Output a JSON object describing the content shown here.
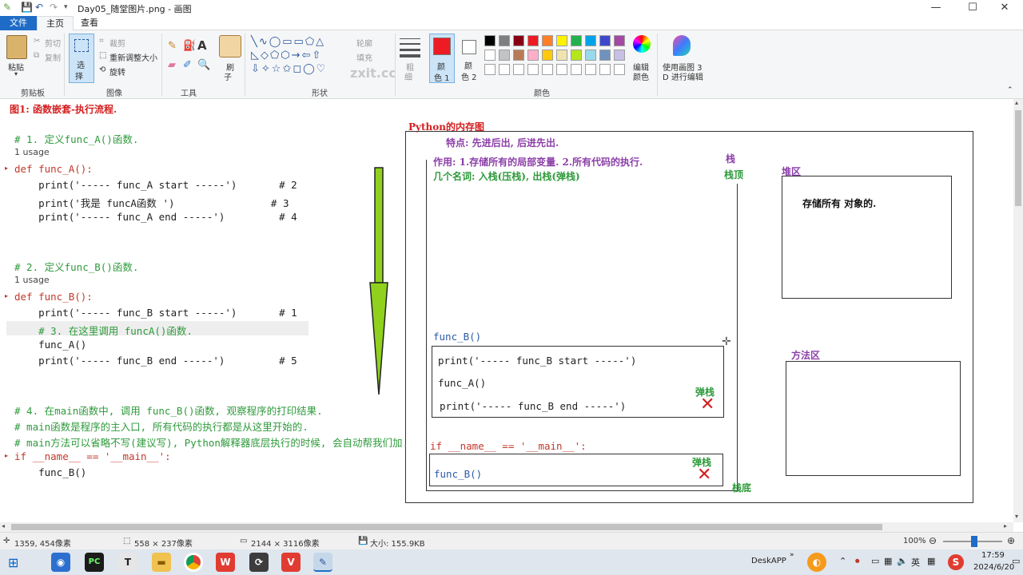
{
  "window": {
    "title": "Day05_随堂图片.png - 画图",
    "controls": {
      "minimize": "—",
      "maximize": "☐",
      "close": "✕"
    }
  },
  "tabs": [
    {
      "label": "文件"
    },
    {
      "label": "主页"
    },
    {
      "label": "查看"
    }
  ],
  "ribbon": {
    "clipboard": {
      "paste": "粘贴",
      "cut": "剪切",
      "copy": "复制",
      "group": "剪贴板"
    },
    "image": {
      "select": "选",
      "select2": "择",
      "crop": "裁剪",
      "resize": "重新调整大小",
      "rotate": "旋转",
      "group": "图像"
    },
    "tools": {
      "group": "工具"
    },
    "brushes": {
      "label": "刷",
      "label2": "子"
    },
    "shapes": {
      "outline": "轮廓",
      "fill": "填充",
      "group": "形状"
    },
    "size": {
      "label": "粗",
      "label2": "细"
    },
    "color1": {
      "label": "颜",
      "label2": "色 1"
    },
    "color2": {
      "label": "颜",
      "label2": "色 2"
    },
    "colors_group": "颜色",
    "edit_colors": {
      "label": "编辑",
      "label2": "颜色"
    },
    "paint3d": {
      "label": "使用画图 3",
      "label2": "D 进行编辑"
    },
    "watermark": "zxit.cc",
    "palette_row1": [
      "#000000",
      "#7f7f7f",
      "#880015",
      "#ed1c24",
      "#ff7f27",
      "#fff200",
      "#22b14c",
      "#00a2e8",
      "#3f48cc",
      "#a349a4"
    ],
    "palette_row2": [
      "#ffffff",
      "#c3c3c3",
      "#b97a57",
      "#ffaec9",
      "#ffc90e",
      "#efe4b0",
      "#b5e61d",
      "#99d9ea",
      "#7092be",
      "#c8bfe7"
    ],
    "color1_value": "#ed1c24",
    "color2_value": "#ffffff"
  },
  "canvas": {
    "figure_title": "图1: 函数嵌套-执行流程.",
    "code_lines": [
      {
        "text": "# 1. 定义func_A()函数.",
        "cls": "cmt"
      },
      {
        "text": "1 usage",
        "cls": "gray"
      },
      {
        "text": "def func_A():",
        "cls": "kw"
      },
      {
        "text": "    print('----- func_A start -----')       # 2",
        "cls": ""
      },
      {
        "text": "    print('我是 funcA函数 ')                # 3",
        "cls": ""
      },
      {
        "text": "    print('----- func_A end -----')         # 4",
        "cls": ""
      },
      {
        "text": "# 2. 定义func_B()函数.",
        "cls": "cmt"
      },
      {
        "text": "1 usage",
        "cls": "gray"
      },
      {
        "text": "def func_B():",
        "cls": "kw"
      },
      {
        "text": "    print('----- func_B start -----')       # 1",
        "cls": ""
      },
      {
        "text": "    # 3. 在这里调用 funcA()函数.",
        "cls": "cmt"
      },
      {
        "text": "    func_A()",
        "cls": ""
      },
      {
        "text": "    print('----- func_B end -----')         # 5",
        "cls": ""
      },
      {
        "text": "# 4. 在main函数中, 调用 func_B()函数, 观察程序的打印结果.",
        "cls": "cmt"
      },
      {
        "text": "# main函数是程序的主入口, 所有代码的执行都是从这里开始的.",
        "cls": "cmt"
      },
      {
        "text": "# main方法可以省略不写(建议写), Python解释器底层执行的时候, 会自动帮我们加.",
        "cls": "cmt"
      },
      {
        "text": "if __name__ == '__main__':",
        "cls": "kw"
      },
      {
        "text": "    func_B()",
        "cls": ""
      }
    ],
    "memory": {
      "title": "Python的内存图",
      "feature": "特点: 先进后出, 后进先出.",
      "purpose": "作用: 1.存储所有的局部变量.  2.所有代码的执行.",
      "terms": "几个名词:  入栈(压栈),  出栈(弹栈)",
      "stack_label": "栈",
      "stack_top": "栈顶",
      "stack_bottom": "栈底",
      "heap_label": "堆区",
      "heap_text": "存储所有 对象的.",
      "method_label": "方法区",
      "frame_b_label": "func_B()",
      "frame_b_lines": [
        "print('----- func_B start -----')",
        "func_A()",
        "print('----- func_B end -----')"
      ],
      "pop1": "弹栈",
      "main_label": "if __name__ == '__main__':",
      "main_call": "func_B()",
      "pop2": "弹栈",
      "x_mark": "✕"
    }
  },
  "status": {
    "cursor": "1359, 454像素",
    "selection": "558 × 237像素",
    "image_size": "2144 × 3116像素",
    "file_size": "大小: 155.9KB",
    "zoom": "100%"
  },
  "taskbar": {
    "deskapp": "DeskAPP",
    "time": "17:59",
    "date": "2024/6/20",
    "lang": "英",
    "chevron": "»"
  }
}
